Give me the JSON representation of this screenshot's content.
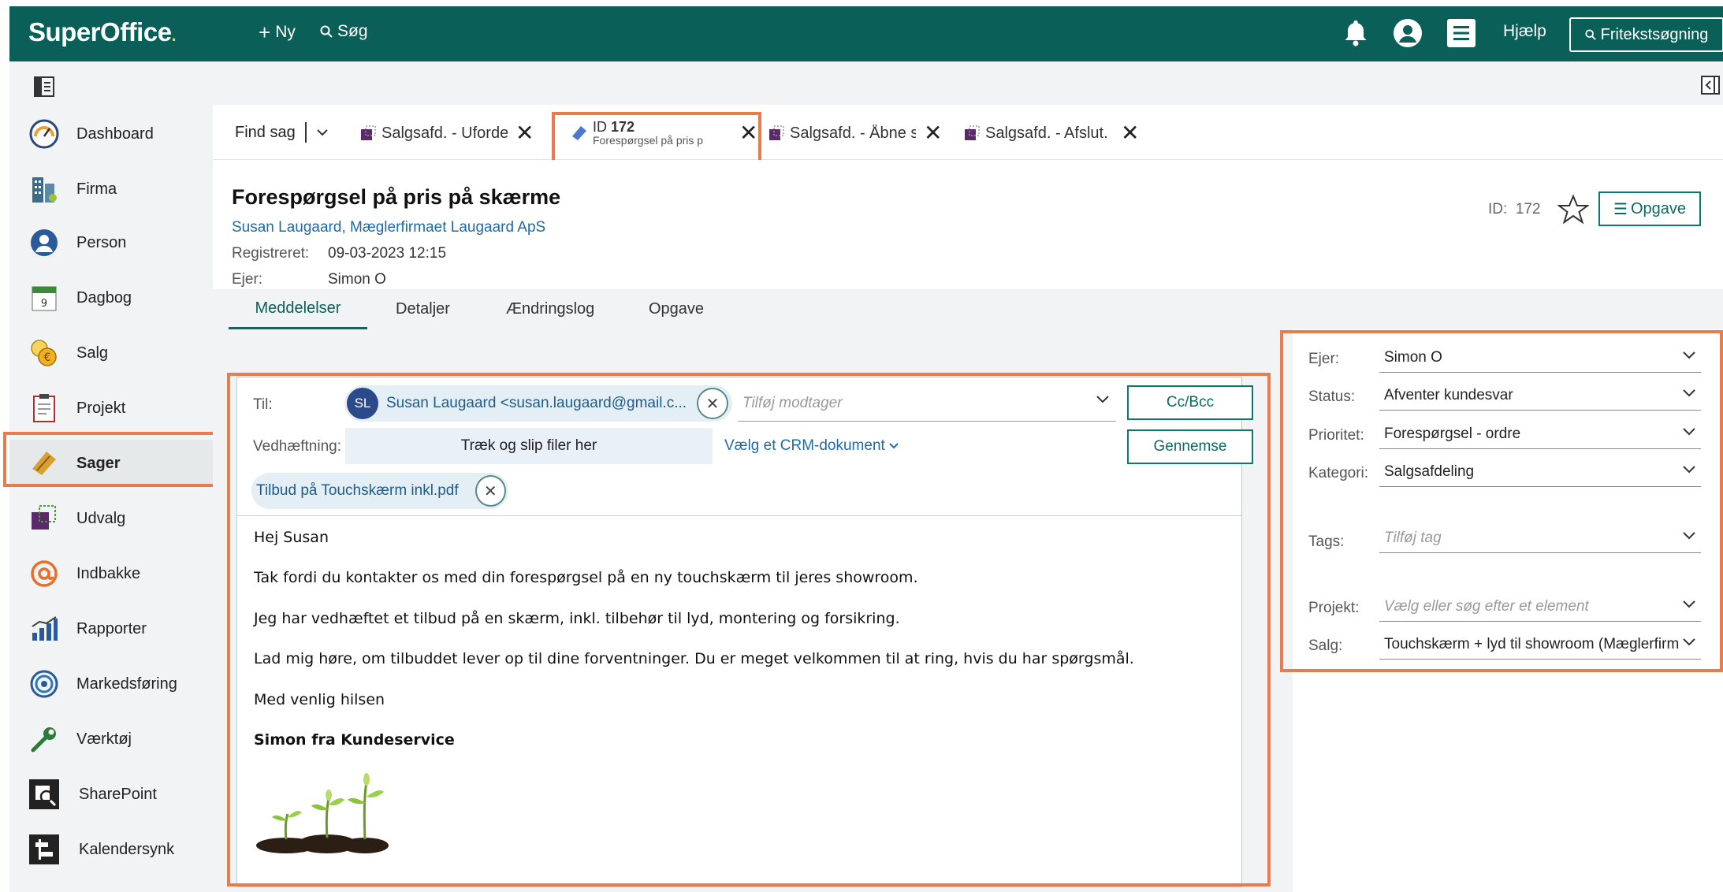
{
  "topbar": {
    "logo": "SuperOffice",
    "logo_dot": ".",
    "new_label": "Ny",
    "search_label": "Søg",
    "help_label": "Hjælp",
    "free_search_label": "Fritekstsøgning",
    "icons": [
      "bell-icon",
      "user-icon",
      "menu-icon",
      "search-icon"
    ]
  },
  "nav": {
    "items": [
      {
        "label": "Dashboard",
        "icon": "dashboard-gauge-icon"
      },
      {
        "label": "Firma",
        "icon": "building-icon"
      },
      {
        "label": "Person",
        "icon": "person-icon"
      },
      {
        "label": "Dagbog",
        "icon": "calendar-icon",
        "day": "9"
      },
      {
        "label": "Salg",
        "icon": "coins-icon"
      },
      {
        "label": "Projekt",
        "icon": "clipboard-icon"
      },
      {
        "label": "Sager",
        "icon": "ticket-icon",
        "active": true
      },
      {
        "label": "Udvalg",
        "icon": "selection-icon"
      },
      {
        "label": "Indbakke",
        "icon": "at-sign-icon"
      },
      {
        "label": "Rapporter",
        "icon": "bar-chart-icon"
      },
      {
        "label": "Markedsføring",
        "icon": "target-icon"
      },
      {
        "label": "Værktøj",
        "icon": "wrench-icon"
      },
      {
        "label": "SharePoint",
        "icon": "sharepoint-icon"
      },
      {
        "label": "Kalendersynk",
        "icon": "calendar-sync-icon"
      }
    ]
  },
  "tabs": {
    "find_label": "Find sag",
    "items": [
      {
        "label": "Salgsafd. - Uforde"
      },
      {
        "id_prefix": "ID",
        "id": "172",
        "sublabel": "Forespørgsel på pris p"
      },
      {
        "label": "Salgsafd. - Åbne s"
      },
      {
        "label": "Salgsafd. - Afslut."
      }
    ]
  },
  "case": {
    "title": "Forespørgsel på pris på skærme",
    "contact": "Susan Laugaard, Mæglerfirmaet Laugaard ApS",
    "registered_label": "Registreret:",
    "registered_value": "09-03-2023 12:15",
    "owner_label": "Ejer:",
    "owner_value": "Simon O",
    "id_label": "ID:",
    "id_value": "172",
    "task_button": "Opgave"
  },
  "subtabs": [
    "Meddelelser",
    "Detaljer",
    "Ændringslog",
    "Opgave"
  ],
  "message": {
    "to_label": "Til:",
    "recipient_initials": "SL",
    "recipient": "Susan Laugaard <susan.laugaard@gmail.c...",
    "add_recipient_placeholder": "Tilføj modtager",
    "cc_button": "Cc/Bcc",
    "attachment_label": "Vedhæftning:",
    "drop_zone": "Træk og slip filer her",
    "crm_link": "Vælg et CRM-dokument",
    "browse_button": "Gennemse",
    "attachment_file": "Tilbud på Touchskærm inkl.pdf",
    "body": {
      "greeting": "Hej Susan",
      "p1": "Tak fordi du kontakter os med din forespørgsel på en ny touchskærm til jeres showroom.",
      "p2": "Jeg har vedhæftet et tilbud på en skærm, inkl. tilbehør til lyd, montering og forsikring.",
      "p3": "Lad mig høre, om tilbuddet lever op til dine forventninger. Du er meget velkommen til at ring, hvis du har spørgsmål.",
      "closing": "Med venlig hilsen",
      "signature": "Simon fra Kundeservice"
    }
  },
  "properties": {
    "owner_label": "Ejer:",
    "owner": "Simon O",
    "status_label": "Status:",
    "status": "Afventer kundesvar",
    "priority_label": "Prioritet:",
    "priority": "Forespørgsel - ordre",
    "category_label": "Kategori:",
    "category": "Salgsafdeling",
    "tags_label": "Tags:",
    "tags_placeholder": "Tilføj tag",
    "project_label": "Projekt:",
    "project_placeholder": "Vælg eller søg efter et element",
    "sale_label": "Salg:",
    "sale": "Touchskærm + lyd til showroom (Mæglerfirm"
  },
  "colors": {
    "brand": "#0a5f58",
    "highlight": "#e87c4d",
    "link": "#1f6aa5"
  }
}
